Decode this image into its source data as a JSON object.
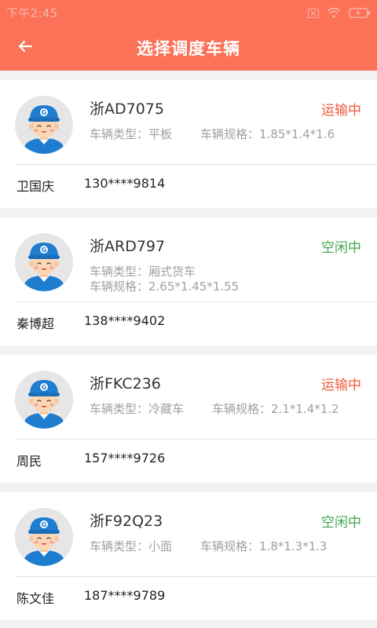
{
  "status_bar": {
    "time": "下午2:45"
  },
  "app_bar": {
    "title": "选择调度车辆"
  },
  "labels": {
    "type_prefix": "车辆类型：",
    "size_prefix": "车辆规格："
  },
  "colors": {
    "primary": "#fb7258",
    "busy": "#ef5b3a",
    "idle": "#3fa64f"
  },
  "vehicles": [
    {
      "plate": "浙AD7075",
      "status": "运输中",
      "status_kind": "busy",
      "type": "车辆类型：平板",
      "spec": "车辆规格：1.85*1.4*1.6",
      "driver": "卫国庆",
      "phone": "130****9814"
    },
    {
      "plate": "浙ARD797",
      "status": "空闲中",
      "status_kind": "idle",
      "type": "车辆类型：厢式货车",
      "spec": "车辆规格：2.65*1.45*1.55",
      "driver": "秦博超",
      "phone": "138****9402"
    },
    {
      "plate": "浙FKC236",
      "status": "运输中",
      "status_kind": "busy",
      "type": "车辆类型：冷藏车",
      "spec": "车辆规格：2.1*1.4*1.2",
      "driver": "周民",
      "phone": "157****9726"
    },
    {
      "plate": "浙F92Q23",
      "status": "空闲中",
      "status_kind": "idle",
      "type": "车辆类型：小面",
      "spec": "车辆规格：1.8*1.3*1.3",
      "driver": "陈文佳",
      "phone": "187****9789"
    }
  ]
}
